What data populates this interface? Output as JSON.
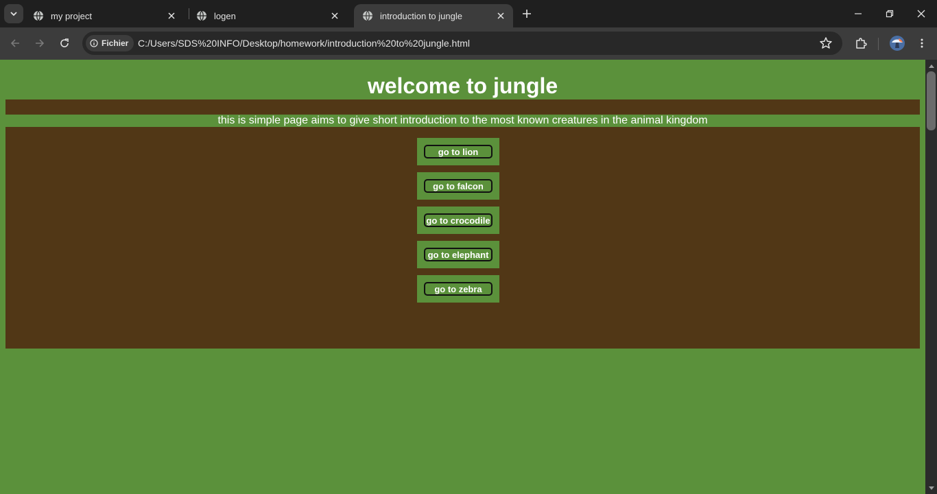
{
  "browser": {
    "tabs": [
      {
        "title": "my project",
        "active": false
      },
      {
        "title": "logen",
        "active": false
      },
      {
        "title": "introduction to jungle",
        "active": true
      }
    ],
    "site_chip_label": "Fichier",
    "url": "C:/Users/SDS%20INFO/Desktop/homework/introduction%20to%20jungle.html"
  },
  "page": {
    "heading": "welcome to jungle",
    "intro": "this is simple page aims to give short introduction to the most known creatures in the animal kingdom",
    "buttons": [
      {
        "label": "go to lion"
      },
      {
        "label": "go to falcon"
      },
      {
        "label": "go to crocodile"
      },
      {
        "label": "go to elephant"
      },
      {
        "label": "go to zebra"
      }
    ]
  },
  "colors": {
    "background_green": "#5b913b",
    "panel_brown": "#513716",
    "text": "#ffffff"
  }
}
